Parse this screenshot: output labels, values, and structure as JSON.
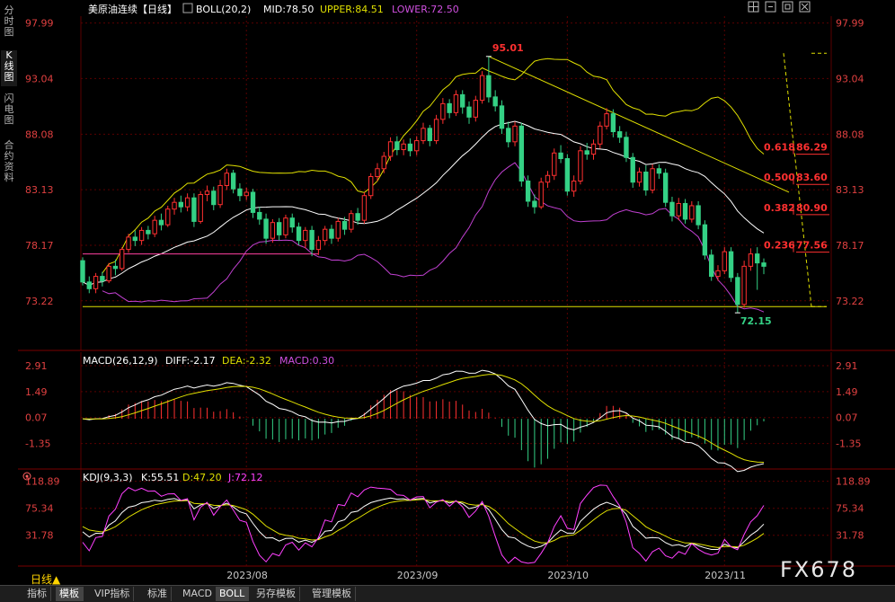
{
  "left_tabs": [
    "分时图",
    "K线图",
    "闪电图",
    "合约资料"
  ],
  "bottom_tabs": [
    "指标",
    "模板",
    "VIP指标",
    "标准",
    "MACD",
    "BOLL",
    "另存模板",
    "管理模板"
  ],
  "active_bottom_tabs": [
    "模板",
    "BOLL"
  ],
  "period_label": "日线▲",
  "watermark": "FX678",
  "header": {
    "symbol": "美原油连续【日线】",
    "boll": "BOLL(20,2)",
    "mid": "MID:78.50",
    "upper": "UPPER:84.51",
    "lower": "LOWER:72.50",
    "toolbar_icons": [
      "grid-icon",
      "collapse-icon",
      "fullscreen-icon",
      "close-icon"
    ]
  },
  "colors": {
    "up": "#ff3030",
    "down": "#34d185",
    "mid_line": "#ffffff",
    "upper_line": "#e0e000",
    "lower_line": "#c040d0",
    "fib": "#ff3030",
    "trend": "#e0e000",
    "diff": "#ffffff",
    "dea": "#e0e000",
    "kdj_k": "#ffffff",
    "kdj_d": "#e0e000",
    "kdj_j": "#ff40ff",
    "grid": "#5a0000"
  },
  "chart_data": [
    {
      "type": "candlestick",
      "title": "美原油连续【日线】",
      "y_ticks": [
        97.99,
        93.04,
        88.08,
        83.13,
        78.17,
        73.22
      ],
      "ylim": [
        70.4,
        98.6
      ],
      "x_ticks": [
        "2023/08",
        "2023/09",
        "2023/10",
        "2023/11"
      ],
      "x_tick_index": [
        25,
        51,
        74,
        98
      ],
      "annotations": {
        "high": {
          "label": "95.01",
          "index": 62,
          "value": 95.01
        },
        "low": {
          "label": "72.15",
          "index": 100,
          "value": 72.15
        }
      },
      "fib_levels": [
        {
          "label": "0.618",
          "value": 86.29
        },
        {
          "label": "0.500",
          "value": 83.6
        },
        {
          "label": "0.382",
          "value": 80.9
        },
        {
          "label": "0.236",
          "value": 77.56
        }
      ],
      "fib_value_labels": [
        "86.29",
        "83.60",
        "80.90",
        "77.56"
      ],
      "horizontal_lines": [
        77.4,
        72.7
      ],
      "candles": [
        [
          0,
          76.8,
          74.9,
          77.1,
          74.6
        ],
        [
          1,
          74.9,
          74.3,
          75.4,
          73.9
        ],
        [
          2,
          74.3,
          75.4,
          75.7,
          73.9
        ],
        [
          3,
          75.4,
          75.0,
          75.8,
          74.5
        ],
        [
          4,
          75.0,
          76.3,
          76.6,
          74.8
        ],
        [
          5,
          76.3,
          76.1,
          76.9,
          75.5
        ],
        [
          6,
          76.1,
          77.8,
          78.0,
          75.9
        ],
        [
          7,
          77.8,
          78.9,
          79.2,
          77.5
        ],
        [
          8,
          78.9,
          78.6,
          79.5,
          78.1
        ],
        [
          9,
          78.6,
          79.5,
          79.8,
          78.2
        ],
        [
          10,
          79.5,
          79.2,
          79.9,
          78.7
        ],
        [
          11,
          79.2,
          80.4,
          80.8,
          78.9
        ],
        [
          12,
          80.4,
          80.0,
          81.0,
          79.5
        ],
        [
          13,
          80.0,
          81.4,
          81.7,
          79.8
        ],
        [
          14,
          81.4,
          82.0,
          82.4,
          80.9
        ],
        [
          15,
          82.0,
          81.6,
          82.6,
          81.1
        ],
        [
          16,
          81.6,
          82.4,
          82.8,
          81.2
        ],
        [
          17,
          82.4,
          80.3,
          82.8,
          79.8
        ],
        [
          18,
          80.3,
          82.7,
          83.0,
          80.1
        ],
        [
          19,
          82.7,
          83.0,
          83.5,
          82.1
        ],
        [
          20,
          83.0,
          81.8,
          83.4,
          81.3
        ],
        [
          21,
          81.8,
          83.5,
          84.0,
          81.5
        ],
        [
          22,
          83.5,
          84.6,
          85.0,
          83.1
        ],
        [
          23,
          84.6,
          83.2,
          84.9,
          82.8
        ],
        [
          24,
          83.2,
          82.6,
          83.7,
          82.1
        ],
        [
          25,
          82.6,
          82.9,
          83.3,
          82.2
        ],
        [
          26,
          82.9,
          81.1,
          83.2,
          80.6
        ],
        [
          27,
          81.1,
          80.5,
          81.6,
          80.0
        ],
        [
          28,
          80.5,
          78.8,
          81.0,
          78.3
        ],
        [
          29,
          78.8,
          80.2,
          80.5,
          78.4
        ],
        [
          30,
          80.2,
          79.1,
          80.6,
          78.6
        ],
        [
          31,
          79.1,
          80.6,
          80.9,
          78.8
        ],
        [
          32,
          80.6,
          79.8,
          81.0,
          79.3
        ],
        [
          33,
          79.8,
          78.6,
          80.2,
          78.2
        ],
        [
          34,
          78.6,
          79.5,
          79.8,
          77.9
        ],
        [
          35,
          79.5,
          77.8,
          79.9,
          77.2
        ],
        [
          36,
          77.8,
          78.6,
          79.0,
          77.3
        ],
        [
          37,
          78.6,
          79.6,
          79.9,
          78.2
        ],
        [
          38,
          79.6,
          78.8,
          80.0,
          78.3
        ],
        [
          39,
          78.8,
          80.3,
          80.6,
          78.5
        ],
        [
          40,
          80.3,
          79.6,
          80.7,
          79.1
        ],
        [
          41,
          79.6,
          81.0,
          81.3,
          79.3
        ],
        [
          42,
          81.0,
          80.4,
          81.5,
          80.0
        ],
        [
          43,
          80.4,
          82.6,
          82.9,
          80.1
        ],
        [
          44,
          82.6,
          84.3,
          84.6,
          82.3
        ],
        [
          45,
          84.3,
          85.0,
          85.5,
          83.9
        ],
        [
          46,
          85.0,
          86.1,
          86.5,
          84.6
        ],
        [
          47,
          86.1,
          87.4,
          87.8,
          85.7
        ],
        [
          48,
          87.4,
          86.7,
          87.9,
          86.2
        ],
        [
          49,
          86.7,
          87.2,
          87.6,
          86.2
        ],
        [
          50,
          87.2,
          86.6,
          87.7,
          86.1
        ],
        [
          51,
          86.6,
          87.5,
          87.9,
          86.2
        ],
        [
          52,
          87.5,
          88.6,
          89.1,
          87.2
        ],
        [
          53,
          88.6,
          87.5,
          88.9,
          87.0
        ],
        [
          54,
          87.5,
          89.4,
          89.8,
          87.2
        ],
        [
          55,
          89.4,
          90.8,
          91.3,
          89.0
        ],
        [
          56,
          90.8,
          90.0,
          91.2,
          89.5
        ],
        [
          57,
          90.0,
          91.6,
          92.0,
          89.7
        ],
        [
          58,
          91.6,
          90.5,
          92.0,
          89.9
        ],
        [
          59,
          90.5,
          89.6,
          91.0,
          89.0
        ],
        [
          60,
          89.6,
          91.1,
          91.5,
          89.2
        ],
        [
          61,
          91.1,
          93.3,
          93.7,
          90.8
        ],
        [
          62,
          93.3,
          91.4,
          95.01,
          90.9
        ],
        [
          63,
          91.4,
          90.6,
          92.0,
          90.1
        ],
        [
          64,
          90.6,
          88.6,
          91.1,
          88.1
        ],
        [
          65,
          88.6,
          87.4,
          89.2,
          86.9
        ],
        [
          66,
          87.4,
          88.8,
          89.2,
          87.0
        ],
        [
          67,
          88.8,
          83.9,
          89.1,
          83.4
        ],
        [
          68,
          83.9,
          82.1,
          84.4,
          81.6
        ],
        [
          69,
          82.1,
          81.6,
          82.7,
          81.0
        ],
        [
          70,
          81.6,
          83.8,
          84.2,
          81.4
        ],
        [
          71,
          83.8,
          84.4,
          84.8,
          83.3
        ],
        [
          72,
          84.4,
          86.4,
          86.8,
          84.0
        ],
        [
          73,
          86.4,
          85.9,
          87.1,
          85.5
        ],
        [
          74,
          85.9,
          83.0,
          86.3,
          82.6
        ],
        [
          75,
          83.0,
          83.9,
          84.4,
          82.5
        ],
        [
          76,
          83.9,
          86.6,
          87.0,
          83.6
        ],
        [
          77,
          86.6,
          86.3,
          87.3,
          85.8
        ],
        [
          78,
          86.3,
          87.2,
          87.6,
          85.8
        ],
        [
          79,
          87.2,
          88.8,
          89.2,
          86.8
        ],
        [
          80,
          88.8,
          89.9,
          90.4,
          88.5
        ],
        [
          81,
          89.9,
          88.3,
          90.3,
          87.8
        ],
        [
          82,
          88.3,
          87.8,
          88.8,
          87.3
        ],
        [
          83,
          87.8,
          86.0,
          88.3,
          85.6
        ],
        [
          84,
          86.0,
          83.8,
          86.4,
          83.3
        ],
        [
          85,
          83.8,
          84.7,
          85.1,
          83.4
        ],
        [
          86,
          84.7,
          83.1,
          85.3,
          82.6
        ],
        [
          87,
          83.1,
          85.0,
          85.4,
          82.8
        ],
        [
          88,
          85.0,
          84.6,
          85.4,
          84.1
        ],
        [
          89,
          84.6,
          82.0,
          85.0,
          81.6
        ],
        [
          90,
          82.0,
          80.8,
          82.5,
          80.3
        ],
        [
          91,
          80.8,
          81.9,
          82.4,
          80.4
        ],
        [
          92,
          81.9,
          80.5,
          82.3,
          80.1
        ],
        [
          93,
          80.5,
          81.7,
          82.1,
          80.2
        ],
        [
          94,
          81.7,
          80.0,
          82.1,
          79.6
        ],
        [
          95,
          80.0,
          77.3,
          80.4,
          76.9
        ],
        [
          96,
          77.3,
          75.4,
          77.8,
          75.0
        ],
        [
          97,
          75.4,
          75.9,
          76.4,
          75.0
        ],
        [
          98,
          75.9,
          77.6,
          78.0,
          75.6
        ],
        [
          99,
          77.6,
          75.3,
          78.0,
          74.9
        ],
        [
          100,
          75.3,
          72.9,
          75.7,
          72.15
        ],
        [
          101,
          72.9,
          76.3,
          76.8,
          72.6
        ],
        [
          102,
          76.3,
          77.4,
          77.9,
          75.9
        ],
        [
          103,
          77.4,
          76.6,
          78.0,
          74.2
        ],
        [
          104,
          76.6,
          76.3,
          77.0,
          75.6
        ]
      ]
    },
    {
      "type": "line",
      "title": "MACD(26,12,9)",
      "diff_label": "DIFF:-2.17",
      "dea_label": "DEA:-2.32",
      "macd_label": "MACD:0.30",
      "y_ticks": [
        2.91,
        1.49,
        0.07,
        -1.35
      ],
      "ylim": [
        -2.65,
        3.35
      ]
    },
    {
      "type": "line",
      "title": "KDJ(9,3,3)",
      "k_label": "K:55.51",
      "d_label": "D:47.20",
      "j_label": "J:72.12",
      "y_ticks": [
        118.89,
        75.34,
        31.78
      ],
      "ylim": [
        -15,
        130
      ]
    }
  ]
}
